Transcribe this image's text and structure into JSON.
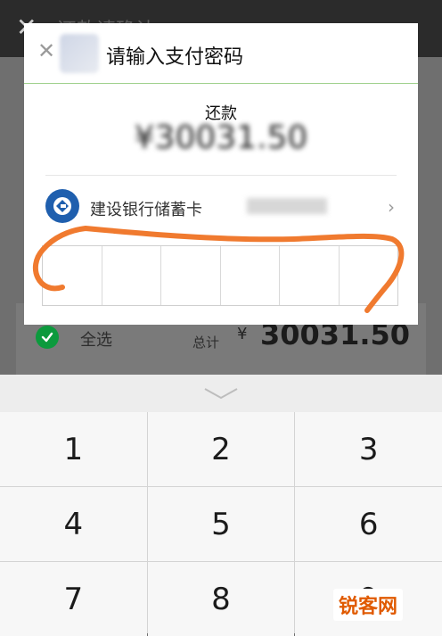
{
  "background": {
    "top_title": "还款请确认",
    "select_all_label": "全选",
    "total_label": "总计",
    "currency_symbol": "¥",
    "total_amount": "30031.50"
  },
  "dialog": {
    "title": "请输入支付密码",
    "subtitle": "还款",
    "amount": "¥30031.50",
    "bank_name": "建设银行储蓄卡"
  },
  "keypad": {
    "keys": [
      "1",
      "2",
      "3",
      "4",
      "5",
      "6",
      "7",
      "8",
      "9"
    ]
  },
  "watermark": "锐客网",
  "colors": {
    "dialog_divider": "#9fd18d",
    "check_green": "#0c9a3d",
    "annotation_orange": "#f07a2f",
    "bank_blue": "#1f5fae"
  }
}
